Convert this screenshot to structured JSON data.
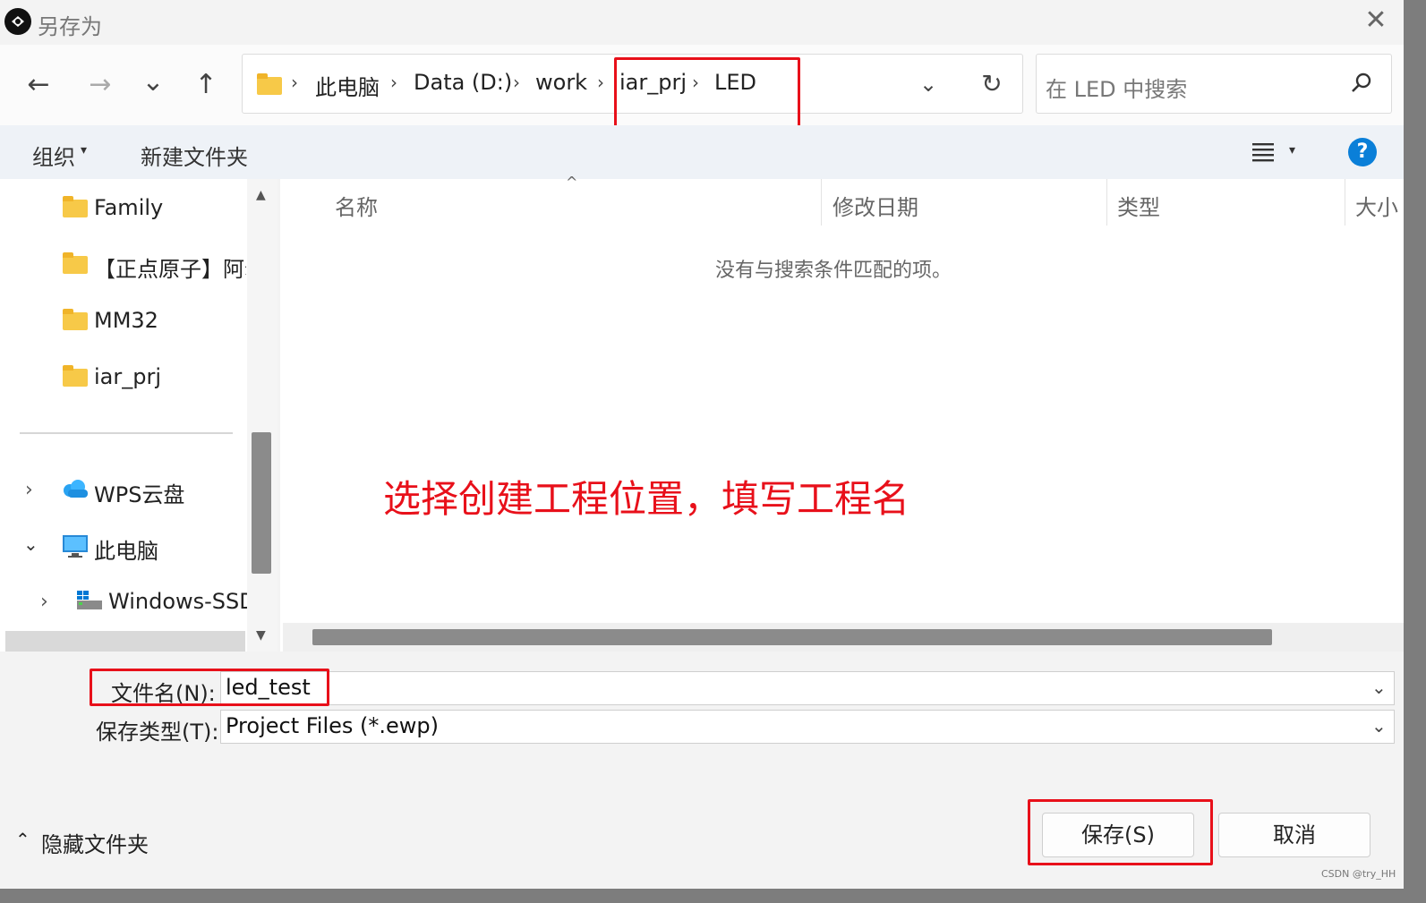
{
  "window": {
    "title": "另存为"
  },
  "nav": {
    "back": "←",
    "forward": "→",
    "recent": "⌄",
    "up": "↑"
  },
  "breadcrumb": [
    "此电脑",
    "Data (D:)",
    "work",
    "iar_prj",
    "LED"
  ],
  "search": {
    "placeholder": "在 LED 中搜索"
  },
  "toolbar": {
    "organize": "组织",
    "new_folder": "新建文件夹"
  },
  "nav_pane": {
    "items": [
      "Family",
      "【正点原子】阿尔",
      "MM32",
      "iar_prj"
    ],
    "wps": "WPS云盘",
    "this_pc": "此电脑",
    "drive": "Windows-SSD"
  },
  "columns": [
    "名称",
    "修改日期",
    "类型",
    "大小"
  ],
  "empty_message": "没有与搜索条件匹配的项。",
  "annotation": "选择创建工程位置，填写工程名",
  "form": {
    "filename_label": "文件名(N):",
    "filename_value": "led_test",
    "filetype_label": "保存类型(T):",
    "filetype_value": "Project Files (*.ewp)"
  },
  "footer": {
    "hide_folders": "隐藏文件夹",
    "save": "保存(S)",
    "cancel": "取消"
  },
  "watermark": "CSDN @try_HH",
  "colors": {
    "accent": "#0a7fd8",
    "annotation": "#e8101a",
    "folder": "#f7c948"
  }
}
